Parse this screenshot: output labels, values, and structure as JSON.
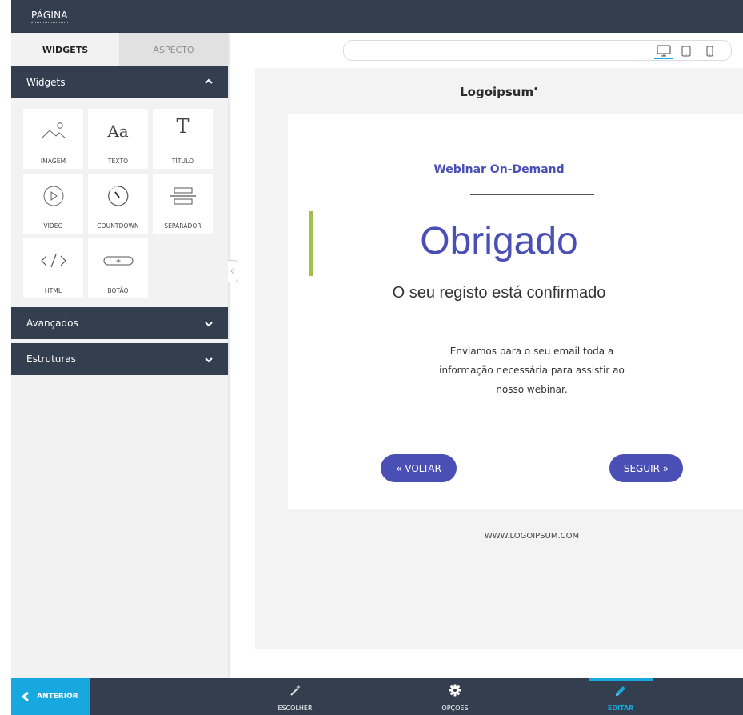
{
  "topbar": {
    "page_tab": "PÁGINA"
  },
  "sidebar": {
    "tabs": [
      {
        "label": "WIDGETS",
        "active": true
      },
      {
        "label": "ASPECTO",
        "active": false
      }
    ],
    "sections": {
      "widgets": {
        "title": "Widgets",
        "expanded": true
      },
      "advanced": {
        "title": "Avançados",
        "expanded": false
      },
      "structures": {
        "title": "Estruturas",
        "expanded": false
      }
    },
    "widgets": [
      {
        "label": "IMAGEM",
        "icon": "image-icon"
      },
      {
        "label": "TEXTO",
        "icon": "text-icon"
      },
      {
        "label": "TÍTULO",
        "icon": "title-icon"
      },
      {
        "label": "VÍDEO",
        "icon": "video-play-icon"
      },
      {
        "label": "COUNTDOWN",
        "icon": "countdown-timer-icon"
      },
      {
        "label": "SEPARADOR",
        "icon": "separator-icon"
      },
      {
        "label": "HTML",
        "icon": "code-icon"
      },
      {
        "label": "BOTÃO",
        "icon": "button-icon"
      }
    ]
  },
  "device_bar": {
    "devices": [
      "desktop-icon",
      "tablet-icon",
      "mobile-icon"
    ],
    "selected": "desktop"
  },
  "canvas": {
    "logo": "Logoipsum",
    "subtitle": "Webinar On-Demand",
    "headline": "Obrigado",
    "confirmation": "O seu registo está confirmado",
    "body_lines": [
      "Enviamos  para o seu email toda a",
      "informação necessária para assistir ao",
      "nosso webinar."
    ],
    "back_button": "« VOLTAR",
    "next_button": "SEGUIR »",
    "footer_url": "WWW.LOGOIPSUM.COM"
  },
  "bottombar": {
    "previous": "ANTERIOR",
    "nav": [
      {
        "label": "ESCOLHER",
        "icon": "magic-wand-icon"
      },
      {
        "label": "OPÇOES",
        "icon": "gear-icon"
      },
      {
        "label": "EDITAR",
        "icon": "pencil-icon",
        "active": true
      }
    ]
  },
  "colors": {
    "dark": "#333f4f",
    "accent_blue": "#18a8e0",
    "brand_purple": "#4a4fb5",
    "accent_green": "#a4bd4f"
  }
}
